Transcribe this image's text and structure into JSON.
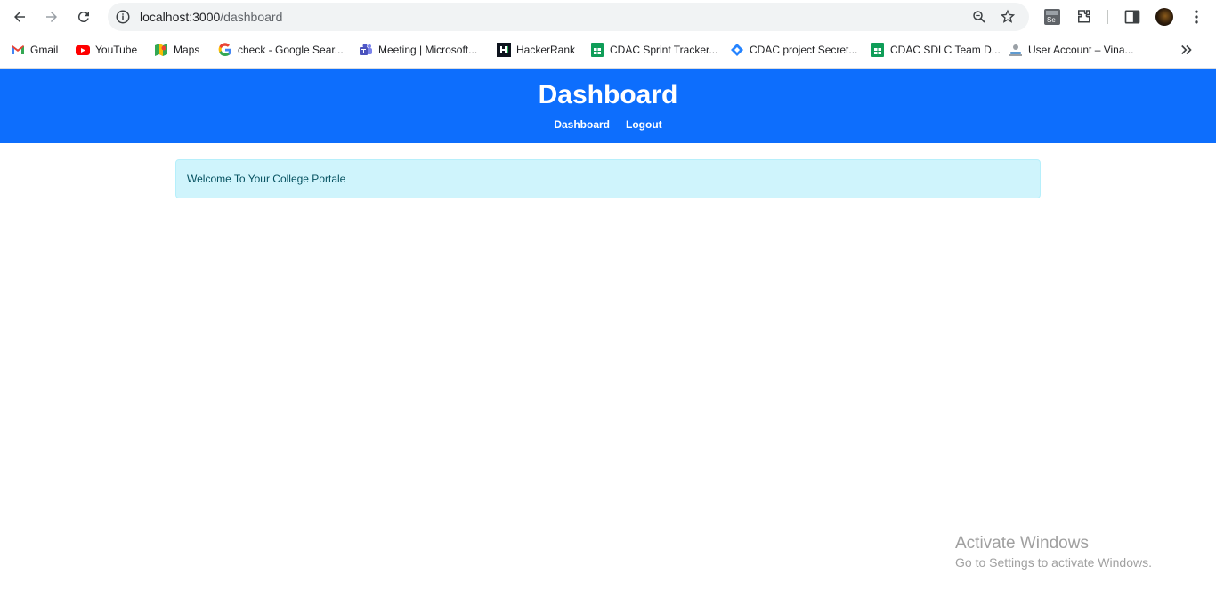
{
  "browser": {
    "url_host": "localhost:3000",
    "url_path": "/dashboard"
  },
  "bookmarks": [
    {
      "label": "Gmail",
      "icon": "gmail-icon"
    },
    {
      "label": "YouTube",
      "icon": "youtube-icon"
    },
    {
      "label": "Maps",
      "icon": "maps-icon"
    },
    {
      "label": "check - Google Sear...",
      "icon": "google-icon"
    },
    {
      "label": "Meeting | Microsoft...",
      "icon": "teams-icon"
    },
    {
      "label": "HackerRank",
      "icon": "hackerrank-icon"
    },
    {
      "label": "CDAC Sprint Tracker...",
      "icon": "sheets-icon"
    },
    {
      "label": "CDAC project Secret...",
      "icon": "jira-icon"
    },
    {
      "label": "CDAC SDLC Team D...",
      "icon": "sheets-icon"
    },
    {
      "label": "User Account – Vina...",
      "icon": "user-account-icon"
    }
  ],
  "app": {
    "title": "Dashboard",
    "nav": [
      "Dashboard",
      "Logout"
    ],
    "alert": "Welcome To Your College Portale",
    "primary_color": "#0d6efd",
    "alert_color": "#cff4fc"
  },
  "watermark": {
    "title": "Activate Windows",
    "subtitle": "Go to Settings to activate Windows."
  }
}
